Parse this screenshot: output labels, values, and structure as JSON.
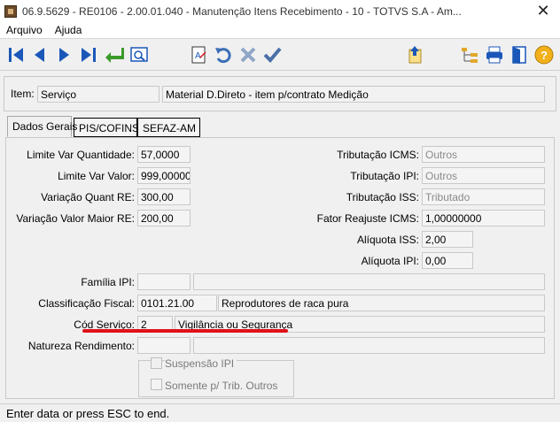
{
  "window": {
    "title": "06.9.5629 - RE0106 - 2.00.01.040 - Manutenção Itens Recebimento - 10 - TOTVS S.A - Am..."
  },
  "menu": {
    "items": [
      "Arquivo",
      "Ajuda"
    ]
  },
  "item": {
    "label": "Item:",
    "code": "Serviço",
    "description": "Material D.Direto - item p/contrato Medição"
  },
  "tabs": [
    "Dados Gerais",
    "PIS/COFINS",
    "SEFAZ-AM"
  ],
  "left": {
    "limite_var_qtd_label": "Limite Var Quantidade:",
    "limite_var_qtd": "57,0000",
    "limite_var_valor_label": "Limite Var Valor:",
    "limite_var_valor": "999,00000",
    "variacao_quant_label": "Variação Quant RE:",
    "variacao_quant": "300,00",
    "variacao_valor_label": "Variação Valor Maior RE:",
    "variacao_valor": "200,00"
  },
  "right": {
    "trib_icms_label": "Tributação ICMS:",
    "trib_icms": "Outros",
    "trib_ipi_label": "Tributação IPI:",
    "trib_ipi": "Outros",
    "trib_iss_label": "Tributação ISS:",
    "trib_iss": "Tributado",
    "fator_label": "Fator Reajuste ICMS:",
    "fator": "1,00000000",
    "aliq_iss_label": "Alíquota ISS:",
    "aliq_iss": "2,00",
    "aliq_ipi_label": "Alíquota IPI:",
    "aliq_ipi": "0,00"
  },
  "lower": {
    "familia_ipi_label": "Família IPI:",
    "familia_ipi": "",
    "familia_ipi_desc": "",
    "class_fiscal_label": "Classificação Fiscal:",
    "class_fiscal": "0101.21.00",
    "class_fiscal_desc": "Reprodutores de raca pura",
    "cod_servico_label": "Cód Serviço:",
    "cod_servico": "2",
    "cod_servico_desc": "Vigilância ou Segurança",
    "natureza_label": "Natureza Rendimento:",
    "natureza": "",
    "natureza_desc": ""
  },
  "options": {
    "suspensao_ipi": "Suspensão IPI",
    "somente_trib": "Somente p/ Trib. Outros"
  },
  "status": {
    "text": "Enter data or press ESC to end."
  },
  "colors": {
    "highlight": "#e0101a",
    "nav_blue": "#1b57b8",
    "confirm_green": "#3a9a2a"
  }
}
